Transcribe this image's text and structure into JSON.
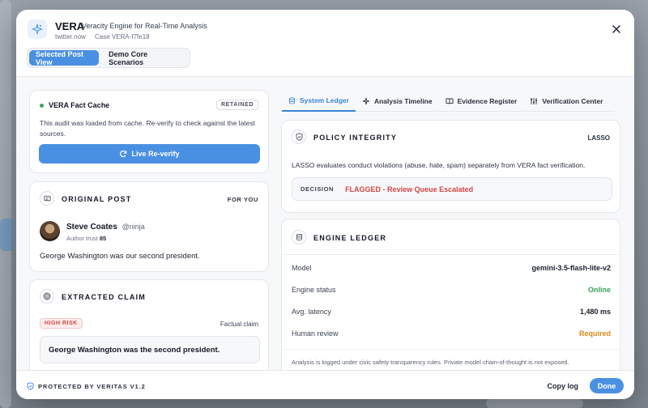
{
  "header": {
    "app_name": "VERA",
    "app_subtitle": "Veracity Engine for Real-Time Analysis",
    "source": "twitter.now",
    "case_id": "Case VERA-f7fe18",
    "view_tabs": [
      "Selected Post View",
      "Demo Core Scenarios"
    ]
  },
  "cache": {
    "title": "VERA Fact Cache",
    "badge": "RETAINED",
    "message": "This audit was loaded from cache. Re-verify to check against the latest sources.",
    "button_label": "Live Re-verify"
  },
  "original_post": {
    "title": "ORIGINAL POST",
    "tag": "FOR YOU",
    "author_name": "Steve Coates",
    "author_handle": "@ninja",
    "author_trust_label": "Author trust",
    "author_trust_value": "85",
    "text": "George Washington was our second president."
  },
  "extracted_claim": {
    "title": "EXTRACTED CLAIM",
    "risk_badge": "HIGH RISK",
    "claim_type": "Factual claim",
    "claim_text": "George Washington was the second president."
  },
  "right_tabs": [
    "System Ledger",
    "Analysis Timeline",
    "Evidence Register",
    "Verification Center"
  ],
  "policy": {
    "title": "POLICY INTEGRITY",
    "tag": "LASSO",
    "description": "LASSO evaluates conduct violations (abuse, hate, spam) separately from VERA fact verification.",
    "decision_label": "DECISION",
    "decision_value": "FLAGGED - Review Queue Escalated"
  },
  "engine": {
    "title": "ENGINE LEDGER",
    "rows": [
      {
        "label": "Model",
        "value": "gemini-3.5-flash-lite-v2"
      },
      {
        "label": "Engine status",
        "value": "Online"
      },
      {
        "label": "Avg. latency",
        "value": "1,480 ms"
      },
      {
        "label": "Human review",
        "value": "Required"
      }
    ],
    "note": "Analysis is logged under civic safety transparency rules. Private model chain-of-thought is not exposed."
  },
  "footer": {
    "protected_by": "PROTECTED BY VERITAS V1.2",
    "copy_log": "Copy log",
    "done": "Done"
  },
  "colors": {
    "accent": "#4a90e2",
    "danger": "#d64545",
    "success": "#3aa35a",
    "warning": "#d98a1e"
  }
}
